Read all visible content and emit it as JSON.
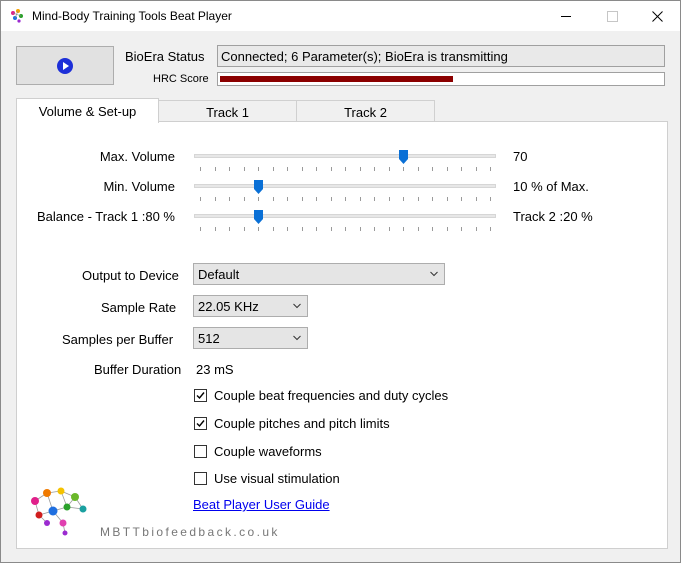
{
  "window": {
    "title": "Mind-Body Training Tools Beat Player",
    "icon": "app-logo-icon",
    "controls": [
      "minimize",
      "maximize",
      "close"
    ]
  },
  "status": {
    "play_icon": "play-icon",
    "bioera_label": "BioEra Status",
    "bioera_text": "Connected; 6 Parameter(s); BioEra is transmitting",
    "hrc_label": "HRC Score",
    "hrc_fraction": 0.53,
    "hrc_color": "#8b0000"
  },
  "tabs": [
    {
      "label": "Volume & Set-up",
      "active": true
    },
    {
      "label": "Track 1",
      "active": false
    },
    {
      "label": "Track 2",
      "active": false
    }
  ],
  "sliders": {
    "max_volume": {
      "label": "Max. Volume",
      "value": "70",
      "fraction": 0.7
    },
    "min_volume": {
      "label": "Min. Volume",
      "value": "10 % of Max.",
      "fraction": 0.2
    },
    "balance": {
      "label": "Balance - Track 1 :80 %",
      "value": "Track 2 :20 %",
      "fraction": 0.2
    }
  },
  "accent_color": "#0a70d6",
  "output": {
    "device_label": "Output to Device",
    "device_value": "Default",
    "sample_rate_label": "Sample Rate",
    "sample_rate_value": "22.05 KHz",
    "samples_per_buffer_label": "Samples per Buffer",
    "samples_per_buffer_value": "512",
    "buffer_duration_label": "Buffer Duration",
    "buffer_duration_value": "23 mS"
  },
  "checkboxes": [
    {
      "label": "Couple beat frequencies and duty cycles",
      "checked": true
    },
    {
      "label": "Couple pitches and pitch limits",
      "checked": true
    },
    {
      "label": "Couple waveforms",
      "checked": false
    },
    {
      "label": "Use visual stimulation",
      "checked": false
    }
  ],
  "footer": {
    "link": "Beat Player User Guide",
    "logo_text": "MBTTbiofeedback.co.uk",
    "logo_icon": "brain-network-logo"
  }
}
